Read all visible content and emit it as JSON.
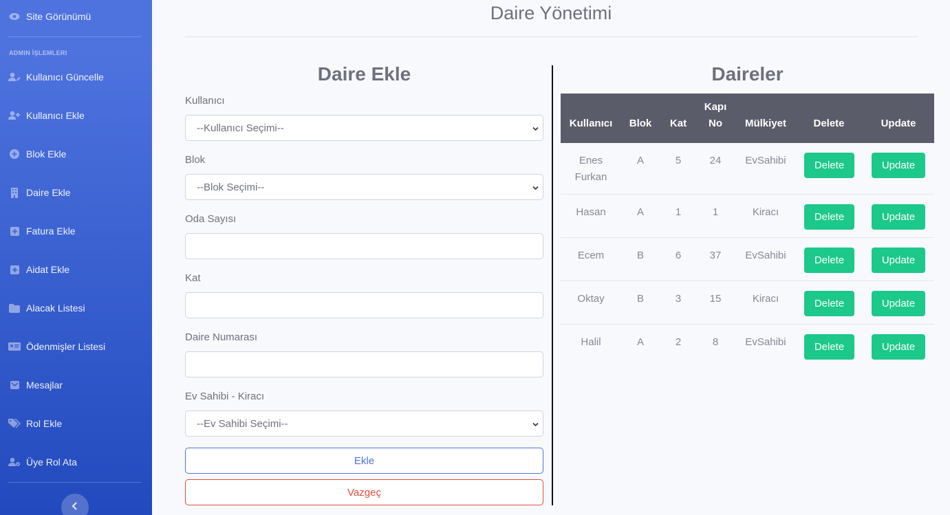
{
  "sidebar": {
    "site_view": "Site Görünümü",
    "heading": "ADMIN İŞLEMLERI",
    "items": [
      {
        "label": "Kullanıcı Güncelle",
        "icon": "user-edit-icon"
      },
      {
        "label": "Kullanıcı Ekle",
        "icon": "user-plus-icon"
      },
      {
        "label": "Blok Ekle",
        "icon": "plus-circle-icon"
      },
      {
        "label": "Daire Ekle",
        "icon": "building-icon"
      },
      {
        "label": "Fatura Ekle",
        "icon": "plus-square-icon"
      },
      {
        "label": "Aidat Ekle",
        "icon": "plus-square-icon"
      },
      {
        "label": "Alacak Listesi",
        "icon": "folder-icon"
      },
      {
        "label": "Ödenmişler Listesi",
        "icon": "id-card-icon"
      },
      {
        "label": "Mesajlar",
        "icon": "envelope-icon"
      },
      {
        "label": "Rol Ekle",
        "icon": "tags-icon"
      },
      {
        "label": "Üye Rol Ata",
        "icon": "user-cog-icon"
      }
    ]
  },
  "page_title": "Daire Yönetimi",
  "form": {
    "title": "Daire Ekle",
    "user_label": "Kullanıcı",
    "user_selected": "--Kullanıcı Seçimi--",
    "block_label": "Blok",
    "block_selected": "--Blok Seçimi--",
    "rooms_label": "Oda Sayısı",
    "rooms_value": "",
    "floor_label": "Kat",
    "floor_value": "",
    "number_label": "Daire Numarası",
    "number_value": "",
    "owner_label": "Ev Sahibi - Kiracı",
    "owner_selected": "--Ev Sahibi Seçimi--",
    "add_button": "Ekle",
    "cancel_button": "Vazgeç"
  },
  "table": {
    "title": "Daireler",
    "headers": [
      "Kullanıcı",
      "Blok",
      "Kat",
      "Kapı No",
      "Mülkiyet",
      "Delete",
      "Update"
    ],
    "rows": [
      {
        "user": "Enes Furkan",
        "block": "A",
        "floor": "5",
        "door": "24",
        "ownership": "EvSahibi"
      },
      {
        "user": "Hasan",
        "block": "A",
        "floor": "1",
        "door": "1",
        "ownership": "Kiracı"
      },
      {
        "user": "Ecem",
        "block": "B",
        "floor": "6",
        "door": "37",
        "ownership": "EvSahibi"
      },
      {
        "user": "Oktay",
        "block": "B",
        "floor": "3",
        "door": "15",
        "ownership": "Kiracı"
      },
      {
        "user": "Halil",
        "block": "A",
        "floor": "2",
        "door": "8",
        "ownership": "EvSahibi"
      }
    ],
    "delete_label": "Delete",
    "update_label": "Update"
  },
  "colors": {
    "sidebar_start": "#4e73df",
    "sidebar_end": "#224abe",
    "header_bg": "#5a5c69",
    "success": "#1cc88a",
    "primary": "#4e73df",
    "danger": "#e74a3b"
  }
}
